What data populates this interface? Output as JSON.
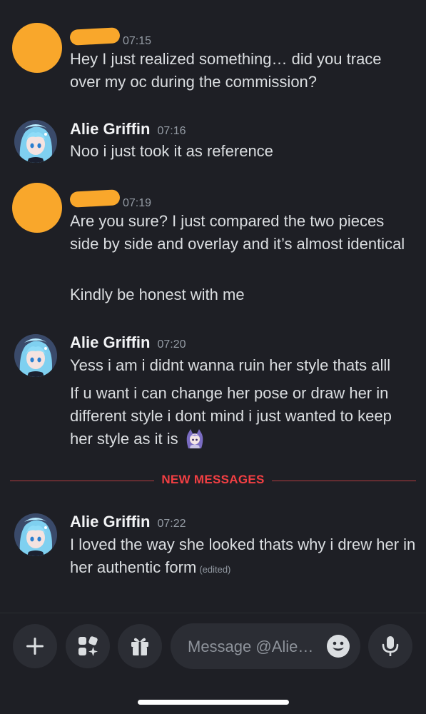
{
  "messages": [
    {
      "author": "",
      "author_redacted": true,
      "time": "07:15",
      "paragraphs": [
        "Hey I just realized something… did you trace over my oc during the commission?"
      ]
    },
    {
      "author": "Alie Griffin",
      "author_redacted": false,
      "time": "07:16",
      "paragraphs": [
        "Noo i just took it as reference"
      ]
    },
    {
      "author": "",
      "author_redacted": true,
      "time": "07:19",
      "paragraphs": [
        "Are you sure? I just compared the two pieces side by side and overlay and it’s almost identical",
        "Kindly be honest with me"
      ]
    },
    {
      "author": "Alie Griffin",
      "author_redacted": false,
      "time": "07:20",
      "paragraphs": [
        "Yess i am i didnt wanna ruin her style thats alll",
        "If u want i can change her pose or draw her in different style i dont mind i just wanted to keep her style as it is"
      ]
    },
    {
      "author": "Alie Griffin",
      "author_redacted": false,
      "time": "07:22",
      "paragraphs": [
        "I loved the way she looked thats why i drew her in her authentic form"
      ],
      "edited_label": "(edited)"
    }
  ],
  "divider": {
    "label": "NEW MESSAGES",
    "color": "#f23f43"
  },
  "composer": {
    "placeholder": "Message @Alie…",
    "icons": [
      "plus-icon",
      "apps-icon",
      "gift-icon",
      "emoji-icon",
      "microphone-icon"
    ]
  },
  "colors": {
    "background": "#1e1f25",
    "redaction": "#f9a72b",
    "timestamp": "#949ba4"
  }
}
